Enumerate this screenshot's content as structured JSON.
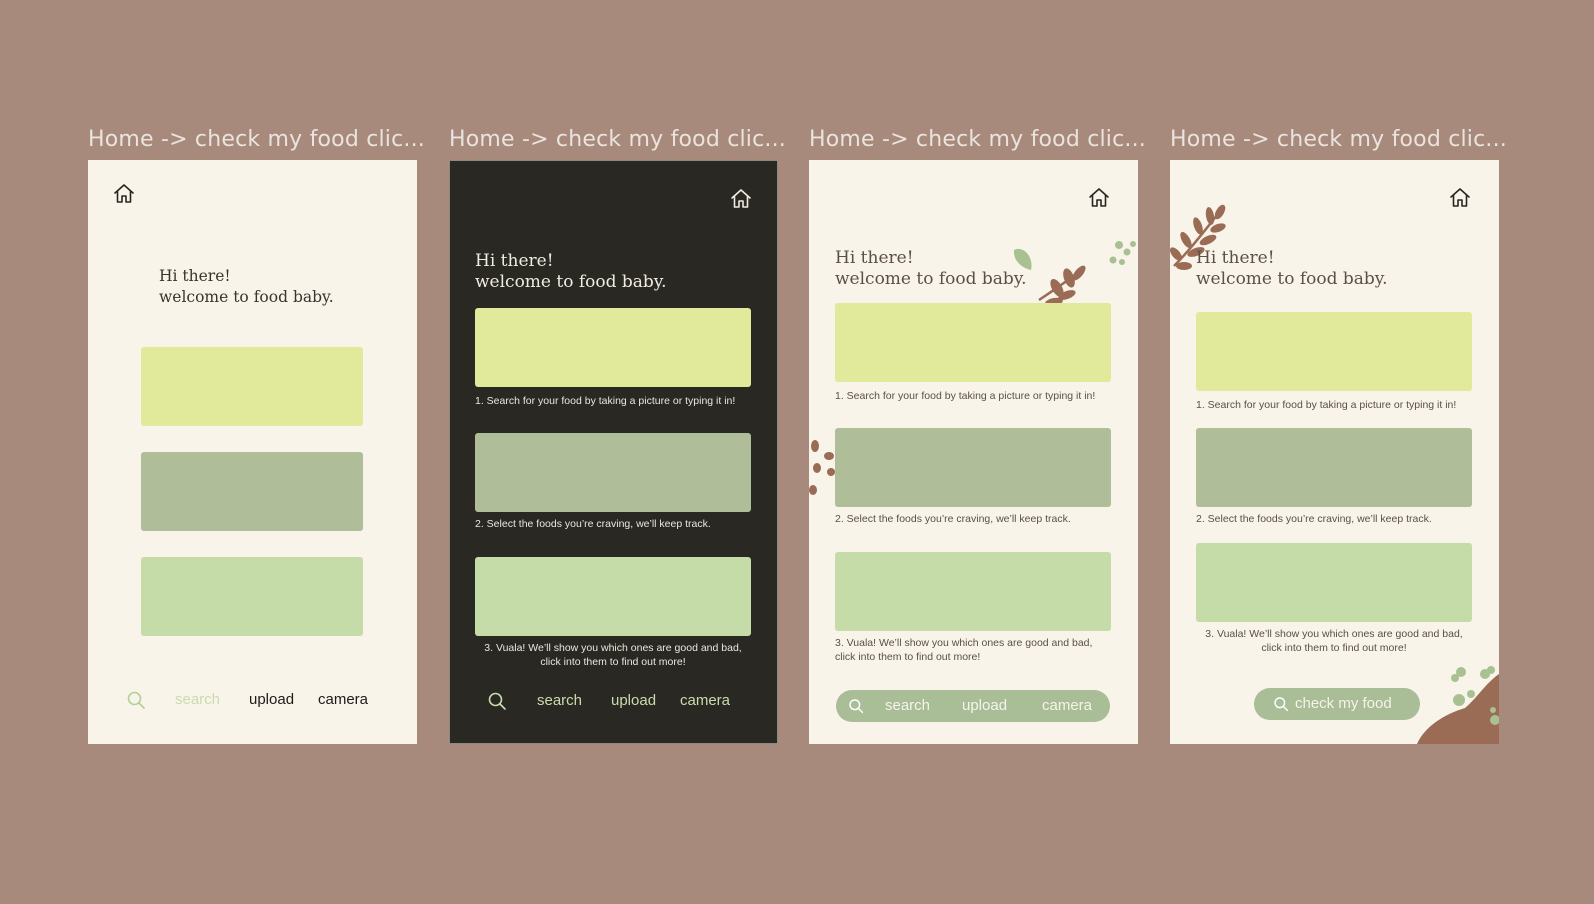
{
  "frame_titles": [
    "Home -> check my food clic...",
    "Home -> check my food clic...",
    "Home -> check my food clic...",
    "Home -> check my food clic..."
  ],
  "greeting": {
    "line1": "Hi there!",
    "line2": "welcome to food baby."
  },
  "steps": {
    "step1": "1. Search for your food by taking a picture or typing it in!",
    "step2": "2. Select the foods you’re craving, we’ll keep track.",
    "step3_line1": "3. Vuala! We’ll show you which ones are good and bad,",
    "step3_line2": "click into them to find out more!"
  },
  "nav": {
    "search": "search",
    "upload": "upload",
    "camera": "camera"
  },
  "cta": {
    "check_my_food": "check my food"
  },
  "colors": {
    "background": "#a78a7c",
    "cream": "#f8f4ea",
    "dark": "#292823",
    "card_yellow": "#e1e99a",
    "card_sage": "#afbe98",
    "card_mint": "#c6dca8",
    "leaf_brown": "#9a6b55",
    "leaf_green": "#a9c191"
  },
  "icons": [
    "home-icon",
    "search-icon",
    "leaf-decoration-icon",
    "bowl-decoration-icon"
  ]
}
